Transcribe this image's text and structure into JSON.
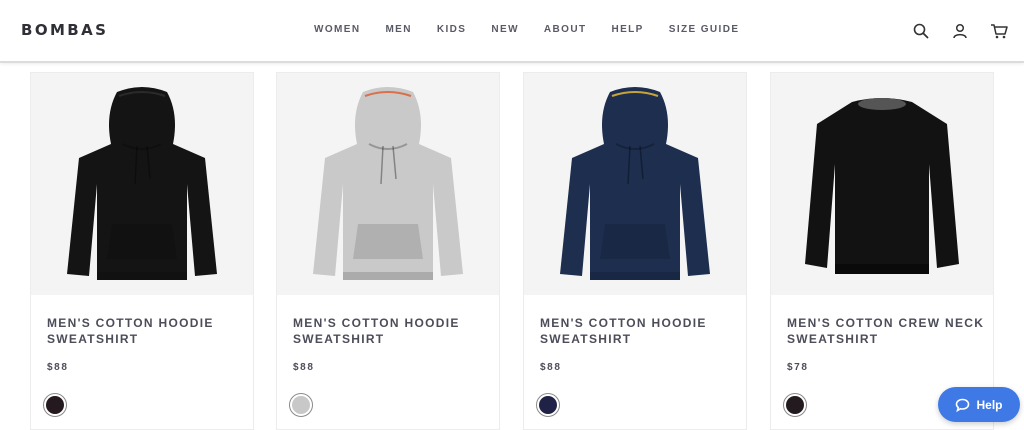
{
  "brand": {
    "logo": "BOMBAS"
  },
  "nav": {
    "items": [
      {
        "label": "WOMEN",
        "key": "women"
      },
      {
        "label": "MEN",
        "key": "men"
      },
      {
        "label": "KIDS",
        "key": "kids"
      },
      {
        "label": "NEW",
        "key": "new"
      },
      {
        "label": "ABOUT",
        "key": "about"
      },
      {
        "label": "HELP",
        "key": "help"
      },
      {
        "label": "SIZE GUIDE",
        "key": "size-guide"
      }
    ]
  },
  "header_icons": [
    "search-icon",
    "account-icon",
    "cart-icon"
  ],
  "products": [
    {
      "title": "MEN'S COTTON HOODIE SWEATSHIRT",
      "price": "$88",
      "garment": "hoodie",
      "body_color": "#141414",
      "trim_color": "#2a2a2a",
      "swatch_color": "#23191f"
    },
    {
      "title": "MEN'S COTTON HOODIE SWEATSHIRT",
      "price": "$88",
      "garment": "hoodie",
      "body_color": "#c9c9c9",
      "trim_color": "#d9704a",
      "swatch_color": "#c8c8c8"
    },
    {
      "title": "MEN'S COTTON HOODIE SWEATSHIRT",
      "price": "$88",
      "garment": "hoodie",
      "body_color": "#1d2e4f",
      "trim_color": "#c8a23a",
      "swatch_color": "#1f2246"
    },
    {
      "title": "MEN'S COTTON CREW NECK SWEATSHIRT",
      "price": "$78",
      "garment": "crew",
      "body_color": "#121212",
      "trim_color": "#8a8a8a",
      "swatch_color": "#231a1f"
    }
  ],
  "help_button": {
    "label": "Help"
  },
  "colors": {
    "accent": "#3f79e6",
    "text": "#4d4d5a",
    "card_bg": "#f4f4f4"
  }
}
